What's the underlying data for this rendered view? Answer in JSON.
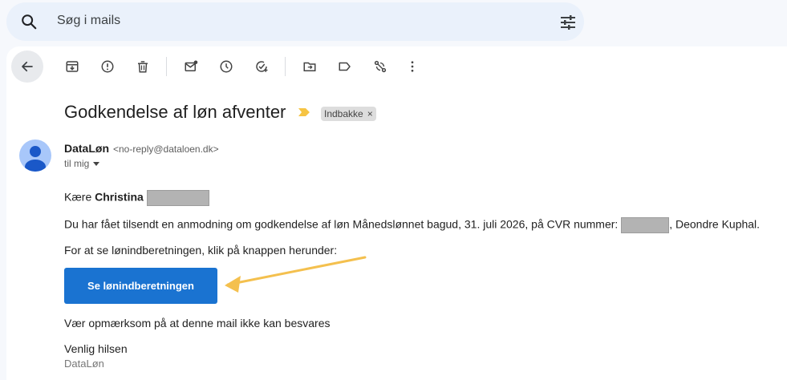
{
  "search": {
    "placeholder": "Søg i mails"
  },
  "email": {
    "subject": "Godkendelse af løn afventer",
    "label": "Indbakke",
    "label_remove": "×",
    "sender_name": "DataLøn",
    "sender_email": "<no-reply@dataloen.dk>",
    "recipient": "til mig",
    "greeting_prefix": "Kære ",
    "greeting_name": "Christina",
    "line1_prefix": "Du har fået tilsendt en anmodning om godkendelse af løn Månedslønnet bagud, 31. juli 2026, på CVR nummer: ",
    "line1_suffix": ", Deondre Kuphal.",
    "line2": "For at se lønindberetningen, klik på knappen herunder:",
    "button_label": "Se lønindberetningen",
    "note": "Vær opmærksom på at denne mail ikke kan besvares",
    "closing": "Venlig hilsen",
    "signature": "DataLøn"
  },
  "colors": {
    "cta": "#1a73d1",
    "annotation_arrow": "#f4c04e",
    "important_marker": "#f6c443"
  }
}
